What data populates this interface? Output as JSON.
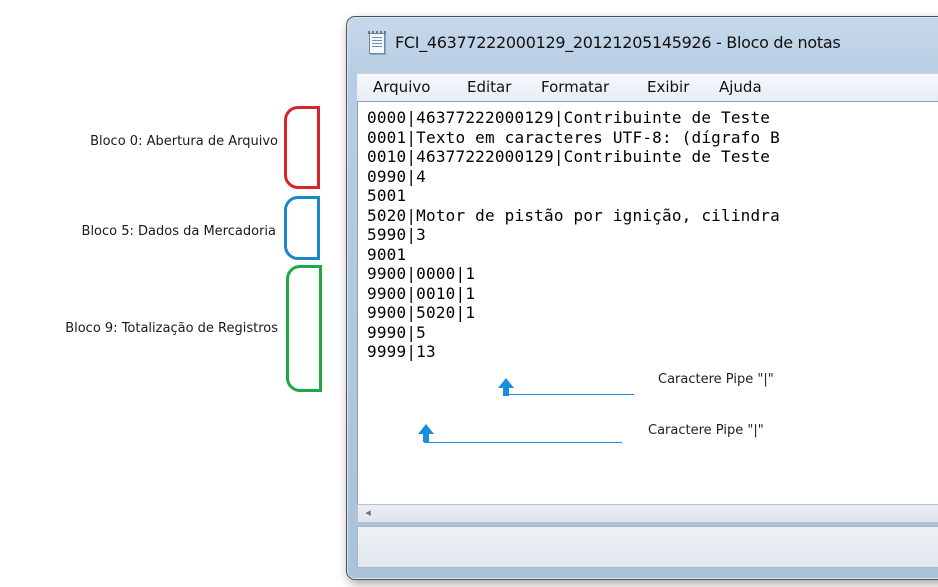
{
  "annotations": {
    "bloco0": "Bloco 0: Abertura de Arquivo",
    "bloco5": "Bloco 5: Dados da Mercadoria",
    "bloco9": "Bloco 9: Totalização de Registros",
    "pipe_note_1": "Caractere Pipe \"|\"",
    "pipe_note_2": "Caractere Pipe \"|\"",
    "colors": {
      "bloco0_brace": "#d9232d",
      "bloco5_brace": "#1c87c9",
      "bloco9_brace": "#1ea84a",
      "arrow": "#1a8fe0"
    }
  },
  "window": {
    "title": "FCI_46377222000129_20121205145926 - Bloco de notas",
    "icon": "notepad-icon"
  },
  "menubar": {
    "items": [
      "Arquivo",
      "Editar",
      "Formatar",
      "Exibir",
      "Ajuda"
    ]
  },
  "editor": {
    "lines": [
      "0000|46377222000129|Contribuinte de Teste",
      "0001|Texto em caracteres UTF-8: (dígrafo B",
      "0010|46377222000129|Contribuinte de Teste",
      "0990|4",
      "5001",
      "5020|Motor de pistão por ignição, cilindra",
      "5990|3",
      "9001",
      "9900|0000|1",
      "9900|0010|1",
      "9900|5020|1",
      "9990|5",
      "9999|13"
    ]
  },
  "scrollbar": {
    "left_arrow": "◂"
  }
}
